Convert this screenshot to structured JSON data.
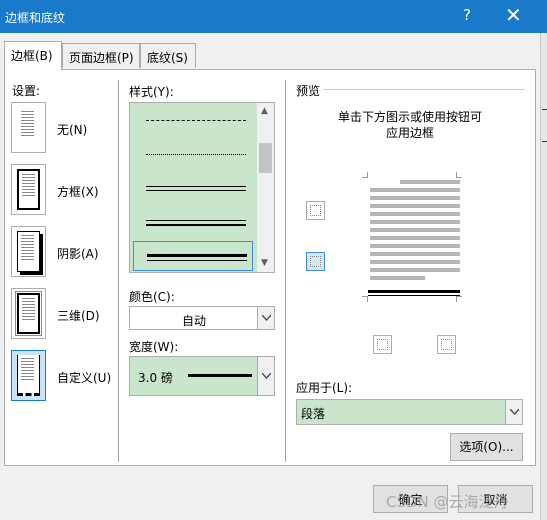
{
  "window": {
    "title": "边框和底纹",
    "help_label": "?",
    "close_label": "✕"
  },
  "tabs": [
    {
      "label": "边框(B)"
    },
    {
      "label": "页面边框(P)"
    },
    {
      "label": "底纹(S)"
    }
  ],
  "settings": {
    "label": "设置:",
    "items": [
      {
        "label": "无(N)",
        "icon": "no-border-icon"
      },
      {
        "label": "方框(X)",
        "icon": "box-border-icon"
      },
      {
        "label": "阴影(A)",
        "icon": "shadow-border-icon"
      },
      {
        "label": "三维(D)",
        "icon": "3d-border-icon"
      },
      {
        "label": "自定义(U)",
        "icon": "custom-border-icon"
      }
    ],
    "selected_index": 4
  },
  "style": {
    "label": "样式(Y):",
    "options": [
      "dash-dot",
      "dash-dot-dot",
      "double",
      "thin-thick",
      "thick-thin"
    ],
    "selected": "thick-thin"
  },
  "color": {
    "label": "颜色(C):",
    "value": "自动"
  },
  "width": {
    "label": "宽度(W):",
    "value": "3.0 磅"
  },
  "preview": {
    "label": "预览",
    "instruction_line1": "单击下方图示或使用按钮可",
    "instruction_line2": "应用边框"
  },
  "apply_to": {
    "label": "应用于(L):",
    "value": "段落"
  },
  "buttons": {
    "options": "选项(O)...",
    "ok": "确定",
    "cancel": "取消"
  },
  "watermark": "CSDN @云海泛舟",
  "colors": {
    "titlebar": "#1979ca",
    "list_bg": "#c9e6cd",
    "selection": "#3c8ee0"
  }
}
